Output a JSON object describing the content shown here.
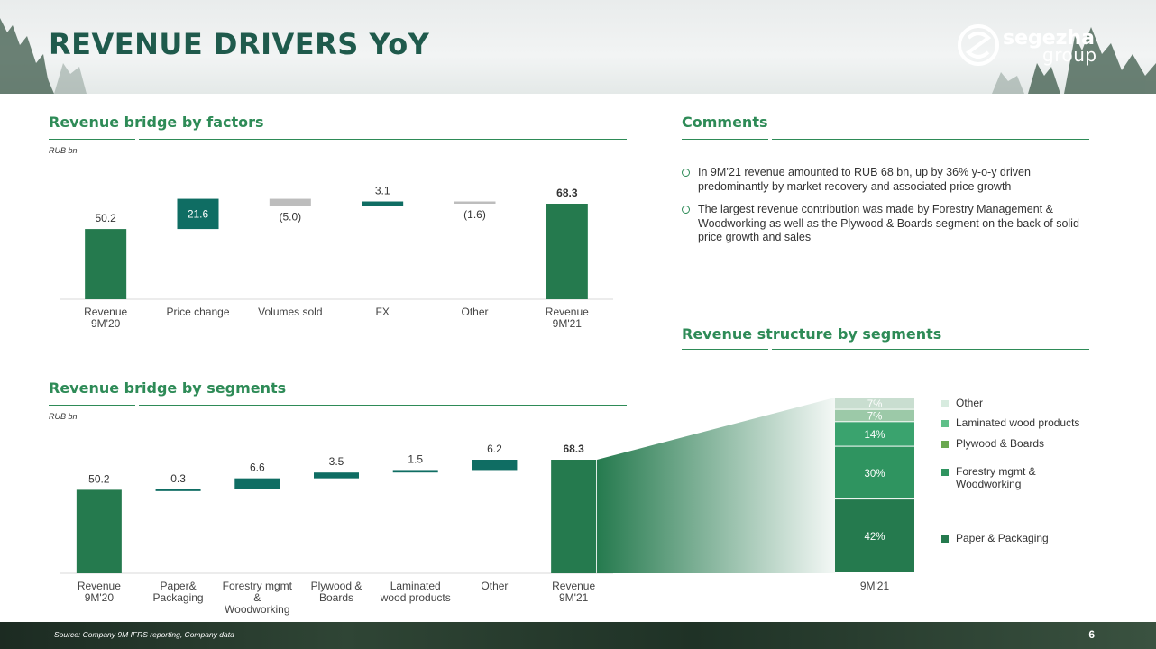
{
  "title": "REVENUE DRIVERS YoY",
  "logo": {
    "brand": "segezha",
    "sub": "group"
  },
  "sections": {
    "factors_title": "Revenue bridge by factors",
    "segments_title": "Revenue bridge by segments",
    "comments_title": "Comments",
    "structure_title": "Revenue structure by segments"
  },
  "unit_factors": "RUB bn",
  "unit_segments": "RUB bn",
  "comments": [
    "In 9M’21 revenue amounted to RUB 68 bn, up by 36% y-o-y driven predominantly by market recovery and associated price growth",
    "The largest revenue contribution was made by Forestry Management & Woodworking as well as the Plywood & Boards segment on the back of solid price growth and sales"
  ],
  "footer": {
    "source": "Source: Company 9M IFRS reporting, Company data",
    "page": "6"
  },
  "colors": {
    "total": "#257a4e",
    "positive": "#0f6d63",
    "negative": "#bdbdbd",
    "title": "#1f5a4c",
    "accent": "#2e8b57"
  },
  "chart_data": [
    {
      "type": "bar",
      "subtype": "waterfall",
      "title": "Revenue bridge by factors",
      "ylabel": "RUB bn",
      "categories": [
        "Revenue 9M'20",
        "Price change",
        "Volumes sold",
        "FX",
        "Other",
        "Revenue 9M'21"
      ],
      "category_lines": [
        [
          "Revenue",
          "9M'20"
        ],
        [
          "Price change"
        ],
        [
          "Volumes sold"
        ],
        [
          "FX"
        ],
        [
          "Other"
        ],
        [
          "Revenue",
          "9M'21"
        ]
      ],
      "values": [
        50.2,
        21.6,
        -5.0,
        3.1,
        -1.6,
        68.3
      ],
      "labels": [
        "50.2",
        "21.6",
        "(5.0)",
        "3.1",
        "(1.6)",
        "68.3"
      ],
      "kinds": [
        "total",
        "positive",
        "negative",
        "positive",
        "negative",
        "total"
      ],
      "ylim": [
        0,
        72
      ]
    },
    {
      "type": "bar",
      "subtype": "waterfall",
      "title": "Revenue bridge by segments",
      "ylabel": "RUB bn",
      "categories": [
        "Revenue 9M'20",
        "Paper& Packaging",
        "Forestry mgmt & Woodworking",
        "Plywood & Boards",
        "Laminated wood products",
        "Other",
        "Revenue 9M'21"
      ],
      "category_lines": [
        [
          "Revenue",
          "9M'20"
        ],
        [
          "Paper&",
          "Packaging"
        ],
        [
          "Forestry mgmt",
          "&",
          "Woodworking"
        ],
        [
          "Plywood &",
          "Boards"
        ],
        [
          "Laminated",
          "wood products"
        ],
        [
          "Other"
        ],
        [
          "Revenue",
          "9M'21"
        ]
      ],
      "values": [
        50.2,
        0.3,
        6.6,
        3.5,
        1.5,
        6.2,
        68.3
      ],
      "labels": [
        "50.2",
        "0.3",
        "6.6",
        "3.5",
        "1.5",
        "6.2",
        "68.3"
      ],
      "kinds": [
        "total",
        "positive",
        "positive",
        "positive",
        "positive",
        "positive",
        "total"
      ],
      "ylim": [
        0,
        72
      ]
    },
    {
      "type": "bar",
      "subtype": "stacked-100",
      "title": "Revenue structure by segments",
      "categories": [
        "9M'21"
      ],
      "series": [
        {
          "name": "Paper & Packaging",
          "values": [
            42
          ],
          "label": "42%",
          "color": "#257a4e"
        },
        {
          "name": "Forestry mgmt & Woodworking",
          "values": [
            30
          ],
          "label": "30%",
          "color": "#2f9460"
        },
        {
          "name": "Plywood & Boards",
          "values": [
            14
          ],
          "label": "14%",
          "color": "#3aa36e"
        },
        {
          "name": "Laminated wood products",
          "values": [
            7
          ],
          "label": "7%",
          "color": "#9cc9a8"
        },
        {
          "name": "Other",
          "values": [
            7
          ],
          "label": "7%",
          "color": "#c9ded0"
        }
      ],
      "legend_lines": {
        "Other": [
          "Other"
        ],
        "Laminated wood products": [
          "Laminated wood products"
        ],
        "Plywood & Boards": [
          "Plywood & Boards"
        ],
        "Forestry mgmt & Woodworking": [
          "Forestry mgmt &",
          "Woodworking"
        ],
        "Paper & Packaging": [
          "Paper & Packaging"
        ]
      },
      "legend_colors": {
        "Other": "#d7ebdf",
        "Laminated wood products": "#5fc089",
        "Plywood & Boards": "#6aa84f",
        "Forestry mgmt & Woodworking": "#2f9460",
        "Paper & Packaging": "#257a4e"
      },
      "legend": "right"
    }
  ]
}
